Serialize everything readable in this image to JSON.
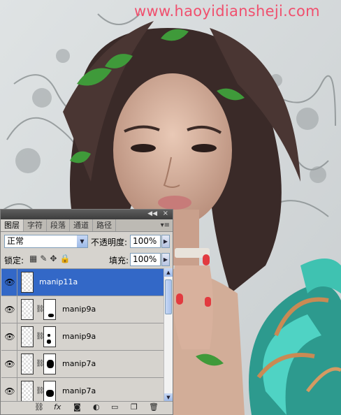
{
  "watermark": "www.haoyidiansheji.com",
  "panel": {
    "tabs": [
      "图层",
      "字符",
      "段落",
      "通道",
      "路径"
    ],
    "active_tab": 0,
    "blend_mode": "正常",
    "opacity_label": "不透明度:",
    "opacity_value": "100%",
    "lock_label": "锁定:",
    "fill_label": "填充:",
    "fill_value": "100%",
    "layers": [
      {
        "name": "manip11a",
        "selected": true
      },
      {
        "name": "manip9a",
        "selected": false
      },
      {
        "name": "manip9a",
        "selected": false
      },
      {
        "name": "manip7a",
        "selected": false
      },
      {
        "name": "manip7a",
        "selected": false
      }
    ],
    "icons": [
      "link-icon",
      "fx-icon",
      "mask-icon",
      "adjustment-icon",
      "folder-icon",
      "new-layer-icon",
      "trash-icon"
    ]
  }
}
